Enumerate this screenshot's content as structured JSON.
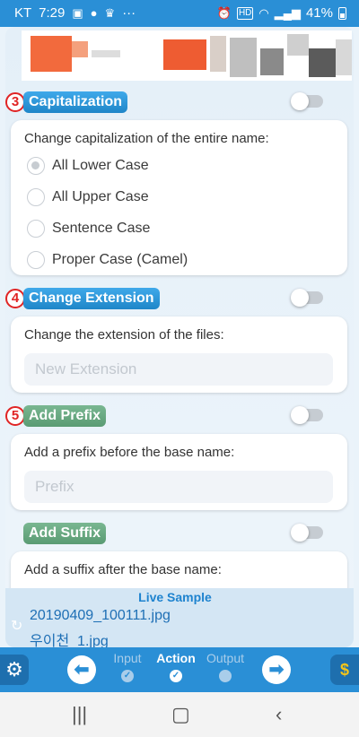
{
  "status_bar": {
    "carrier": "KT",
    "time": "7:29",
    "ellipsis": "···",
    "hd_label": "HD",
    "battery": "41%"
  },
  "sections": {
    "capitalization": {
      "step": "3",
      "title": "Capitalization",
      "description": "Change capitalization of the entire name:",
      "options": [
        "All Lower Case",
        "All Upper Case",
        "Sentence Case",
        "Proper Case (Camel)"
      ],
      "selected": "All Lower Case",
      "enabled": false
    },
    "change_extension": {
      "step": "4",
      "title": "Change Extension",
      "description": "Change the extension of the files:",
      "placeholder": "New Extension",
      "value": "",
      "enabled": false
    },
    "add_prefix": {
      "step": "5",
      "title": "Add Prefix",
      "description": "Add a prefix before the base name:",
      "placeholder": "Prefix",
      "value": "",
      "enabled": false
    },
    "add_suffix": {
      "title": "Add Suffix",
      "description": "Add a suffix after the base name:",
      "enabled": false
    }
  },
  "live_sample": {
    "label": "Live Sample",
    "original": "20190409_100111.jpg",
    "renamed": "우이천_1.jpg"
  },
  "toolbar": {
    "steps": [
      {
        "label": "Input",
        "active": false
      },
      {
        "label": "Action",
        "active": true
      },
      {
        "label": "Output",
        "active": false
      }
    ],
    "icons": [
      "gear-icon",
      "arrow-left-icon",
      "arrow-right-icon",
      "shield-dollar-icon"
    ]
  },
  "colors": {
    "primary": "#2a8fd6",
    "pill_blue": "#1f86c8",
    "pill_green": "#5a9b73",
    "step_red": "#e02424",
    "accent_gold": "#f5c518"
  }
}
